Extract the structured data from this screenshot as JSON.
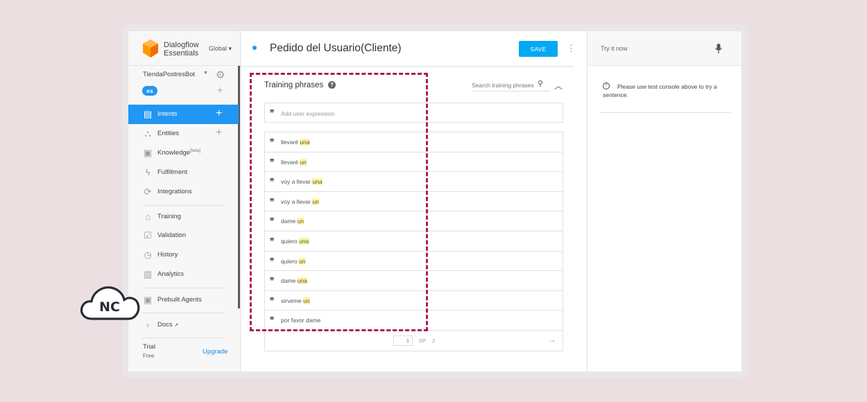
{
  "app": {
    "brand_name": "Dialogflow Essentials",
    "region": "Global ▾",
    "agent_name": "TiendaPostresBot",
    "language": "es"
  },
  "sidebar": {
    "items": [
      {
        "label": "Intents",
        "icon": "chat-icon",
        "active": true
      },
      {
        "label": "Entities",
        "icon": "hierarchy-icon"
      },
      {
        "label": "Knowledge",
        "badge": "[beta]",
        "icon": "book-icon"
      },
      {
        "label": "Fulfillment",
        "icon": "bolt-icon"
      },
      {
        "label": "Integrations",
        "icon": "sync-icon"
      },
      {
        "label": "Training",
        "icon": "graduation-cap-icon"
      },
      {
        "label": "Validation",
        "icon": "checkbox-icon"
      },
      {
        "label": "History",
        "icon": "clock-icon"
      },
      {
        "label": "Analytics",
        "icon": "bar-chart-icon"
      },
      {
        "label": "Prebuilt Agents",
        "icon": "bookmark-icon"
      },
      {
        "label": "Docs",
        "icon": "chevron-right-icon"
      }
    ],
    "trial_label": "Trial",
    "trial_plan": "Free",
    "upgrade_label": "Upgrade"
  },
  "header": {
    "intent_name": "Pedido del Usuario(Cliente)",
    "save_label": "SAVE"
  },
  "training": {
    "title": "Training phrases",
    "search_placeholder": "Search training phrases",
    "add_placeholder": "Add user expression",
    "phrases": [
      {
        "text": "llevaré",
        "highlight": "una"
      },
      {
        "text": "llevaré",
        "highlight": "un"
      },
      {
        "text": "voy a llevar",
        "highlight": "una"
      },
      {
        "text": "voy a llevar",
        "highlight": "un"
      },
      {
        "text": "dame",
        "highlight": "un"
      },
      {
        "text": "quiero",
        "highlight": "una"
      },
      {
        "text": "quiero",
        "highlight": "un"
      },
      {
        "text": "dame",
        "highlight": "una"
      },
      {
        "text": "sirveme",
        "highlight": "un"
      },
      {
        "text": "por favor dame",
        "highlight": ""
      }
    ],
    "pagination": {
      "current": "1",
      "of_label": "OF",
      "total": "2"
    }
  },
  "console": {
    "try_label": "Try it now",
    "info_text": "Please use test console above to try a sentence."
  },
  "overlay": {
    "logo_text": "NC",
    "highlight_color": "#b0175e"
  }
}
